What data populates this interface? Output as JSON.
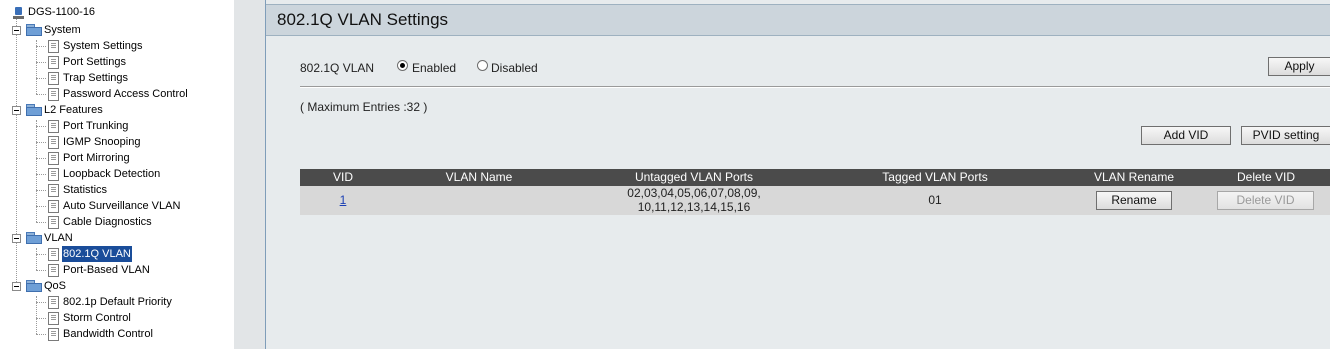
{
  "tree": {
    "device": "DGS-1100-16",
    "groups": [
      {
        "label": "System",
        "items": [
          "System Settings",
          "Port Settings",
          "Trap Settings",
          "Password Access Control"
        ]
      },
      {
        "label": "L2 Features",
        "items": [
          "Port Trunking",
          "IGMP Snooping",
          "Port Mirroring",
          "Loopback Detection",
          "Statistics",
          "Auto Surveillance VLAN",
          "Cable Diagnostics"
        ]
      },
      {
        "label": "VLAN",
        "items": [
          "802.1Q VLAN",
          "Port-Based VLAN"
        ]
      },
      {
        "label": "QoS",
        "items": [
          "802.1p Default Priority",
          "Storm Control",
          "Bandwidth Control"
        ]
      }
    ],
    "selected": "802.1Q VLAN"
  },
  "page": {
    "title": "802.1Q VLAN Settings",
    "vlan_label": "802.1Q VLAN",
    "enabled_label": "Enabled",
    "disabled_label": "Disabled",
    "state": "Enabled",
    "apply_label": "Apply",
    "max_entries": "( Maximum Entries :32 )",
    "add_vid_label": "Add VID",
    "pvid_label": "PVID setting"
  },
  "table": {
    "headers": [
      "VID",
      "VLAN Name",
      "Untagged VLAN Ports",
      "Tagged VLAN Ports",
      "VLAN Rename",
      "Delete VID"
    ],
    "rows": [
      {
        "vid": "1",
        "name": "",
        "untagged_line1": "02,03,04,05,06,07,08,09,",
        "untagged_line2": "10,11,12,13,14,15,16",
        "tagged": "01",
        "rename_label": "Rename",
        "delete_label": "Delete VID"
      }
    ]
  }
}
